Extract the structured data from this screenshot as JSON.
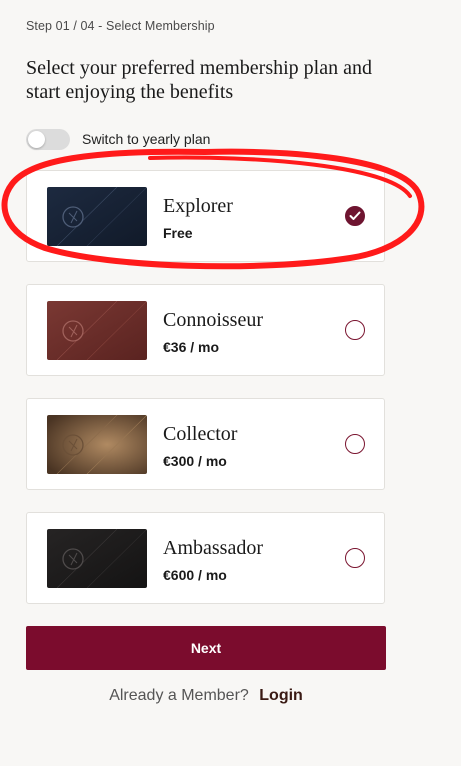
{
  "step_label": "Step 01 / 04 - Select Membership",
  "headline": "Select your preferred membership plan and start enjoying the benefits",
  "yearly_toggle": {
    "label": "Switch to yearly plan",
    "on": false
  },
  "plans": [
    {
      "name": "Explorer",
      "price": "Free",
      "selected": true,
      "card_color": "#1b2638"
    },
    {
      "name": "Connoisseur",
      "price": "€36 / mo",
      "selected": false,
      "card_color": "#6b2d2a"
    },
    {
      "name": "Collector",
      "price": "€300 / mo",
      "selected": false,
      "card_color": "#8a6a49"
    },
    {
      "name": "Ambassador",
      "price": "€600 / mo",
      "selected": false,
      "card_color": "#1e1c1c"
    }
  ],
  "next_label": "Next",
  "member_prompt": "Already a Member?",
  "login_label": "Login",
  "colors": {
    "accent": "#7b0c2d",
    "annotation": "#ff1a1a"
  }
}
